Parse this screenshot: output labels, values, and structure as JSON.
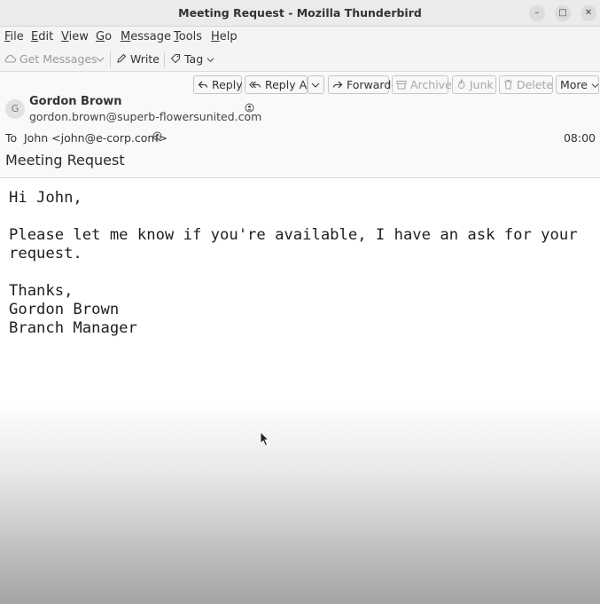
{
  "window": {
    "title": "Meeting Request - Mozilla Thunderbird",
    "min_glyph": "–",
    "max_glyph": "□",
    "close_glyph": "✕"
  },
  "menu": [
    {
      "key": "F",
      "rest": "ile"
    },
    {
      "key": "E",
      "rest": "dit"
    },
    {
      "key": "V",
      "rest": "iew"
    },
    {
      "key": "G",
      "rest": "o"
    },
    {
      "key": "M",
      "rest": "essage"
    },
    {
      "key": "T",
      "rest": "ools"
    },
    {
      "key": "H",
      "rest": "elp"
    }
  ],
  "toolbar": {
    "get_messages": "Get Messages",
    "write": "Write",
    "tag": "Tag"
  },
  "actions": {
    "reply": "Reply",
    "reply_all": "Reply All",
    "forward": "Forward",
    "archive": "Archive",
    "junk": "Junk",
    "delete": "Delete",
    "more": "More"
  },
  "message": {
    "avatar_initial": "G",
    "from_name": "Gordon Brown",
    "from_email": "gordon.brown@superb-flowersunited.com",
    "to_label": "To",
    "to": "John <john@e-corp.com>",
    "time": "08:00",
    "subject": "Meeting Request",
    "body": "Hi John,\n\nPlease let me know if you're available, I have an ask for your\nrequest.\n\nThanks,\nGordon Brown\nBranch Manager"
  }
}
